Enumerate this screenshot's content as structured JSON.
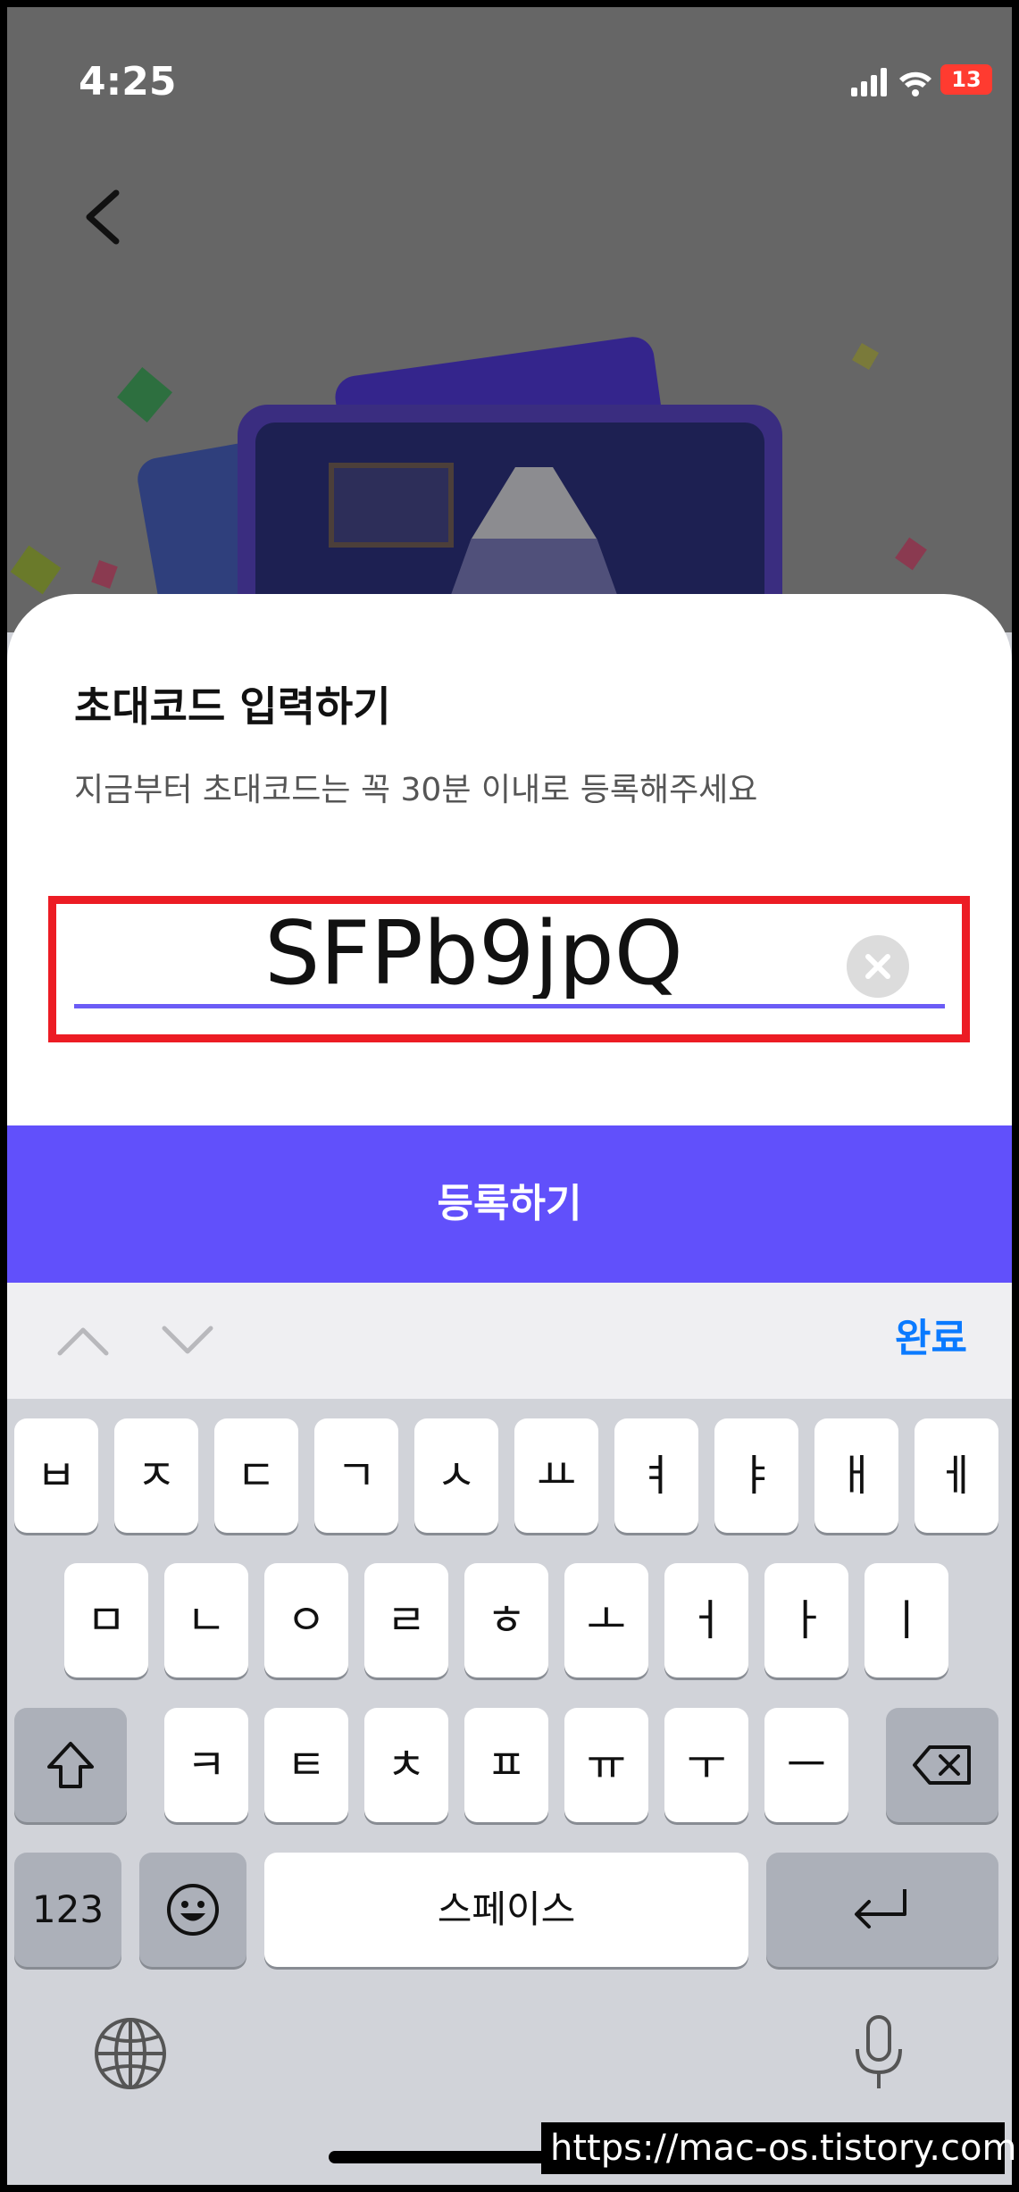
{
  "status_bar": {
    "time": "4:25",
    "battery": "13"
  },
  "dialog": {
    "title": "초대코드 입력하기",
    "subtitle": "지금부터 초대코드는 꼭 30분 이내로 등록해주세요",
    "code_value": "SFPb9jpQ"
  },
  "register_label": "등록하기",
  "accessory": {
    "done_label": "완료"
  },
  "keyboard": {
    "row1": [
      "ㅂ",
      "ㅈ",
      "ㄷ",
      "ㄱ",
      "ㅅ",
      "ㅛ",
      "ㅕ",
      "ㅑ",
      "ㅐ",
      "ㅔ"
    ],
    "row2": [
      "ㅁ",
      "ㄴ",
      "ㅇ",
      "ㄹ",
      "ㅎ",
      "ㅗ",
      "ㅓ",
      "ㅏ",
      "ㅣ"
    ],
    "row3": [
      "ㅋ",
      "ㅌ",
      "ㅊ",
      "ㅍ",
      "ㅠ",
      "ㅜ",
      "ㅡ"
    ],
    "numbers_label": "123",
    "space_label": "스페이스"
  },
  "watermark": "https://mac-os.tistory.com",
  "colors": {
    "accent": "#6150fb",
    "underline": "#6b5cf6",
    "done": "#0a7aff",
    "highlight": "#ec1c24"
  }
}
